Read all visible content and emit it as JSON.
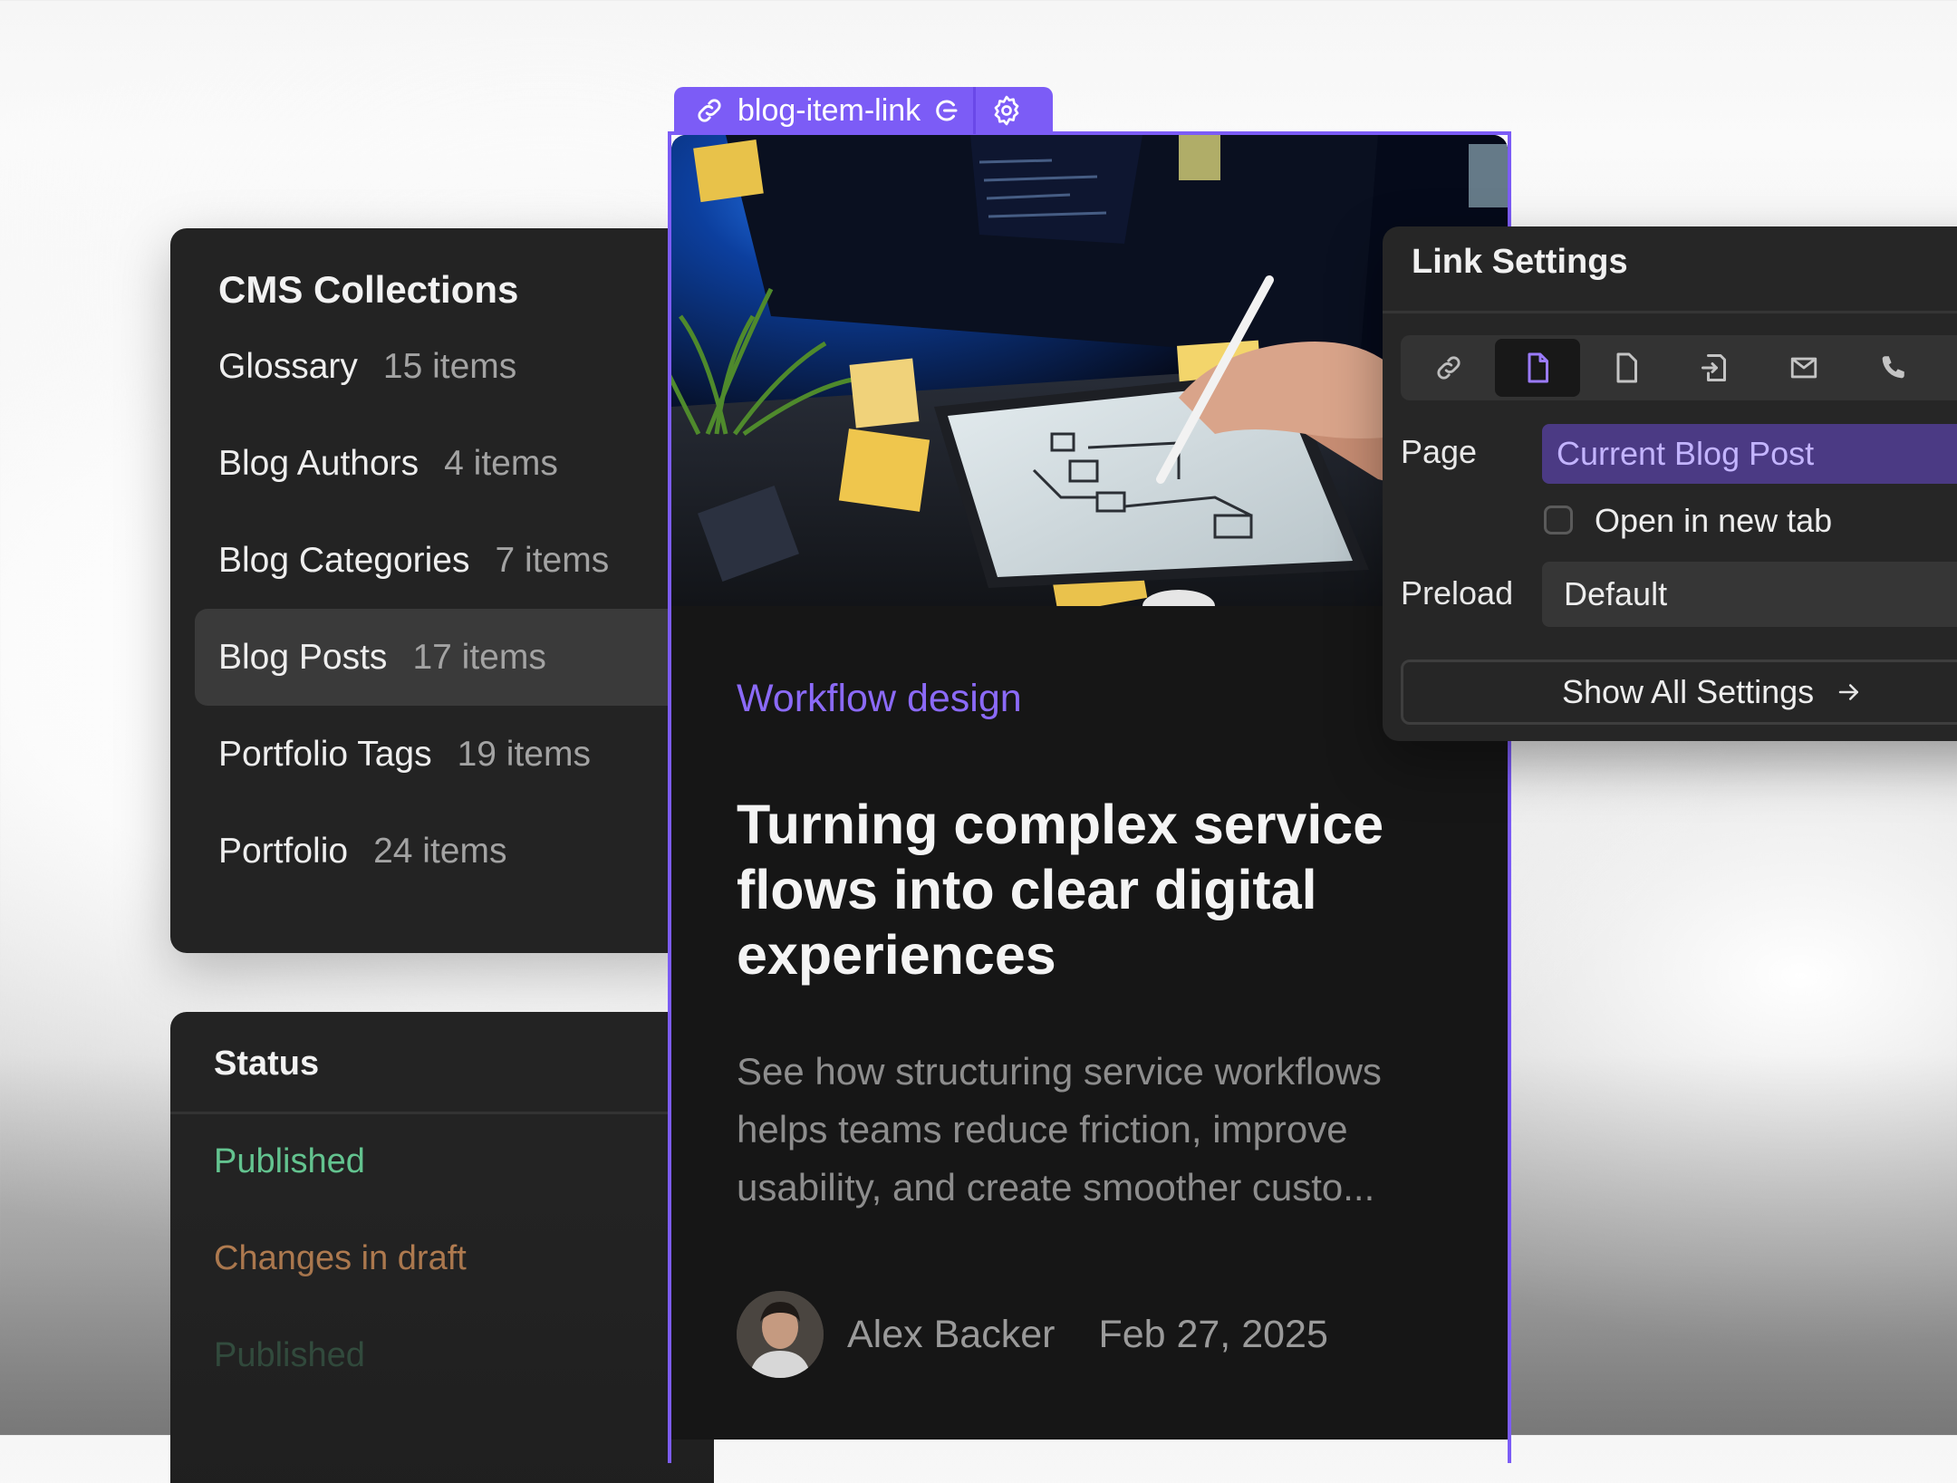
{
  "cms": {
    "title": "CMS Collections",
    "items": [
      {
        "name": "Glossary",
        "count": "15 items"
      },
      {
        "name": "Blog Authors",
        "count": "4 items"
      },
      {
        "name": "Blog Categories",
        "count": "7 items"
      },
      {
        "name": "Blog Posts",
        "count": "17 items"
      },
      {
        "name": "Portfolio Tags",
        "count": "19 items"
      },
      {
        "name": "Portfolio",
        "count": "24 items"
      }
    ],
    "active_index": 3
  },
  "status": {
    "title": "Status",
    "items": [
      {
        "label": "Published",
        "color": "#63c38f"
      },
      {
        "label": "Changes in draft",
        "color": "#c98b58"
      },
      {
        "label": "Published",
        "color": "#3f6a52"
      }
    ]
  },
  "link_tag": {
    "name": "blog-item-link",
    "icons": [
      "link-icon",
      "component-icon",
      "gear-icon"
    ]
  },
  "card": {
    "category": "Workflow design",
    "title": "Turning complex service flows into clear digital experiences",
    "description": "See how structuring service workflows helps teams reduce friction, improve usability, and create smoother custo...",
    "author": "Alex Backer",
    "date": "Feb 27, 2025",
    "image": "person-drawing-flowchart-on-tablet-photo"
  },
  "link_settings": {
    "title": "Link Settings",
    "link_types": [
      "url-link-icon",
      "page-icon",
      "file-icon",
      "section-icon",
      "email-icon",
      "phone-icon"
    ],
    "active_type_index": 1,
    "page_label": "Page",
    "page_value": "Current Blog Post",
    "open_new_tab_label": "Open in new tab",
    "open_new_tab_checked": false,
    "preload_label": "Preload",
    "preload_value": "Default",
    "show_all_label": "Show All Settings"
  },
  "colors": {
    "accent": "#7c5cf6",
    "panel": "#232323",
    "card": "#161616"
  }
}
